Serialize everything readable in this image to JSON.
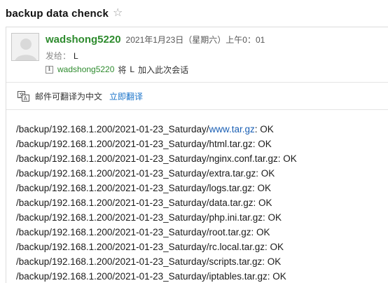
{
  "subject": "backup data chenck",
  "star_icon": "star-outline-icon",
  "sender": {
    "name": "wadshong5220",
    "time": "2021年1月23日（星期六）上午0：01",
    "to_label": "发给：",
    "to_value": "L"
  },
  "info": {
    "icon": "info-icon",
    "user": "wadshong5220",
    "verb": "将",
    "subject_user": "L",
    "tail": "加入此次会话"
  },
  "translate": {
    "icon": "translate-icon",
    "text": "邮件可翻译为中文",
    "link": "立即翻译"
  },
  "body": {
    "lines": [
      {
        "prefix": "/backup/192.168.1.200/2021-01-23_Saturday/",
        "file": "www.tar.gz",
        "is_link": true,
        "suffix": ": OK"
      },
      {
        "prefix": "/backup/192.168.1.200/2021-01-23_Saturday/",
        "file": "html.tar.gz",
        "is_link": false,
        "suffix": ": OK"
      },
      {
        "prefix": "/backup/192.168.1.200/2021-01-23_Saturday/",
        "file": "nginx.conf.tar.gz",
        "is_link": false,
        "suffix": ": OK"
      },
      {
        "prefix": "/backup/192.168.1.200/2021-01-23_Saturday/",
        "file": "extra.tar.gz",
        "is_link": false,
        "suffix": ": OK"
      },
      {
        "prefix": "/backup/192.168.1.200/2021-01-23_Saturday/",
        "file": "logs.tar.gz",
        "is_link": false,
        "suffix": ": OK"
      },
      {
        "prefix": "/backup/192.168.1.200/2021-01-23_Saturday/",
        "file": "data.tar.gz",
        "is_link": false,
        "suffix": ": OK"
      },
      {
        "prefix": "/backup/192.168.1.200/2021-01-23_Saturday/",
        "file": "php.ini.tar.gz",
        "is_link": false,
        "suffix": ": OK"
      },
      {
        "prefix": "/backup/192.168.1.200/2021-01-23_Saturday/",
        "file": "root.tar.gz",
        "is_link": false,
        "suffix": ": OK"
      },
      {
        "prefix": "/backup/192.168.1.200/2021-01-23_Saturday/",
        "file": "rc.local.tar.gz",
        "is_link": false,
        "suffix": ": OK"
      },
      {
        "prefix": "/backup/192.168.1.200/2021-01-23_Saturday/",
        "file": "scripts.tar.gz",
        "is_link": false,
        "suffix": ": OK"
      },
      {
        "prefix": "/backup/192.168.1.200/2021-01-23_Saturday/",
        "file": "iptables.tar.gz",
        "is_link": false,
        "suffix": ": OK"
      }
    ]
  },
  "colors": {
    "sender_green": "#2e8b2e",
    "link_blue": "#1a73c9"
  }
}
